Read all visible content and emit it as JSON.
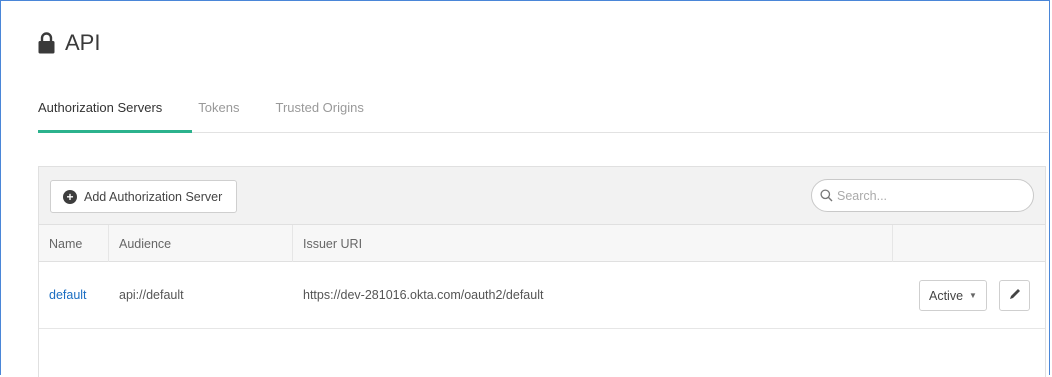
{
  "page": {
    "title": "API"
  },
  "tabs": [
    {
      "label": "Authorization Servers",
      "active": true
    },
    {
      "label": "Tokens",
      "active": false
    },
    {
      "label": "Trusted Origins",
      "active": false
    }
  ],
  "toolbar": {
    "add_label": "Add Authorization Server",
    "search_placeholder": "Search..."
  },
  "table": {
    "columns": [
      "Name",
      "Audience",
      "Issuer URI",
      ""
    ],
    "rows": [
      {
        "name": "default",
        "audience": "api://default",
        "issuer_uri": "https://dev-281016.okta.com/oauth2/default",
        "status": "Active"
      }
    ]
  },
  "colors": {
    "accent_tab": "#2bb28d",
    "link": "#1b6ec2",
    "frame": "#4a86d8"
  }
}
